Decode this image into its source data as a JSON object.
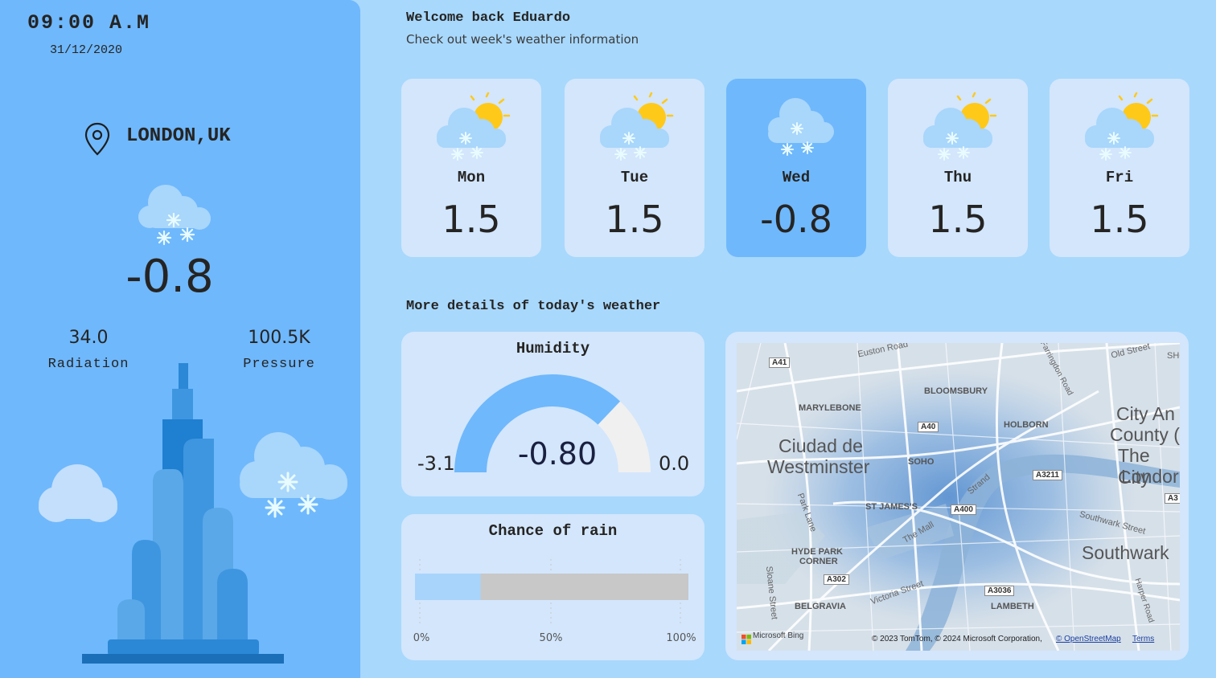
{
  "sidebar": {
    "time": "09:00 A.M",
    "date": "31/12/2020",
    "location": "LONDON,UK",
    "location_icon": "map-pin-icon",
    "today_icon": "snow-cloud-icon",
    "today_temp": "-0.8",
    "stats": [
      {
        "value": "34.0",
        "label": "Radiation"
      },
      {
        "value": "100.5K",
        "label": "Pressure"
      }
    ]
  },
  "header": {
    "welcome": "Welcome back Eduardo",
    "subtitle": "Check out week's weather information"
  },
  "week": [
    {
      "day": "Mon",
      "temp": "1.5",
      "icon": "sun-snow-cloud-icon",
      "active": false
    },
    {
      "day": "Tue",
      "temp": "1.5",
      "icon": "sun-snow-cloud-icon",
      "active": false
    },
    {
      "day": "Wed",
      "temp": "-0.8",
      "icon": "snow-cloud-icon",
      "active": true
    },
    {
      "day": "Thu",
      "temp": "1.5",
      "icon": "sun-snow-cloud-icon",
      "active": false
    },
    {
      "day": "Fri",
      "temp": "1.5",
      "icon": "sun-snow-cloud-icon",
      "active": false
    }
  ],
  "details": {
    "title": "More details of today's weather",
    "humidity": {
      "title": "Humidity",
      "min": "-3.1",
      "max": "0.0",
      "value": "-0.80",
      "fraction": 0.742
    },
    "rain": {
      "title": "Chance of rain",
      "ticks": [
        "0%",
        "50%",
        "100%"
      ],
      "value_fraction": 0.24
    }
  },
  "map": {
    "labels": {
      "euston": "Euston Road",
      "old_street": "Old Street",
      "shc": "SHC",
      "pentonville": "Farringdon Road",
      "bloomsbury": "BLOOMSBURY",
      "marylebone": "MARYLEBONE",
      "holborn": "HOLBORN",
      "westminster1": "Ciudad de",
      "westminster2": "Westminster",
      "soho": "SOHO",
      "city1": "City An",
      "city2": "County (",
      "city3": "The City",
      "city4": "Londor",
      "strand": "Strand",
      "st_james": "ST JAMES'S",
      "park_lane": "Park Lane",
      "the_mall": "The Mall",
      "southwark_street": "Southwark Street",
      "southwark": "Southwark",
      "hyde_park1": "HYDE PARK",
      "hyde_park2": "CORNER",
      "victoria": "Victoria Street",
      "sloane": "Sloane Street",
      "belgravia": "BELGRAVIA",
      "lambeth": "LAMBETH",
      "harper": "Harper Road"
    },
    "roads": [
      "A41",
      "A40",
      "A3211",
      "A400",
      "A3",
      "A302",
      "A3036"
    ],
    "logo": "Microsoft Bing",
    "copyright": "© 2023 TomTom, © 2024 Microsoft Corporation,",
    "osm_link": "© OpenStreetMap",
    "terms_link": "Terms"
  },
  "colors": {
    "page_bg": "#a8d8fc",
    "sidebar_bg": "#6fb8fc",
    "card_bg": "#d3e6fc",
    "active_card": "#6fb8fc",
    "gauge_fill": "#6fb8fc",
    "gauge_rest": "#f0f0f0",
    "rain_fill": "#a8d4fb",
    "rain_rest": "#c8c8c8"
  }
}
